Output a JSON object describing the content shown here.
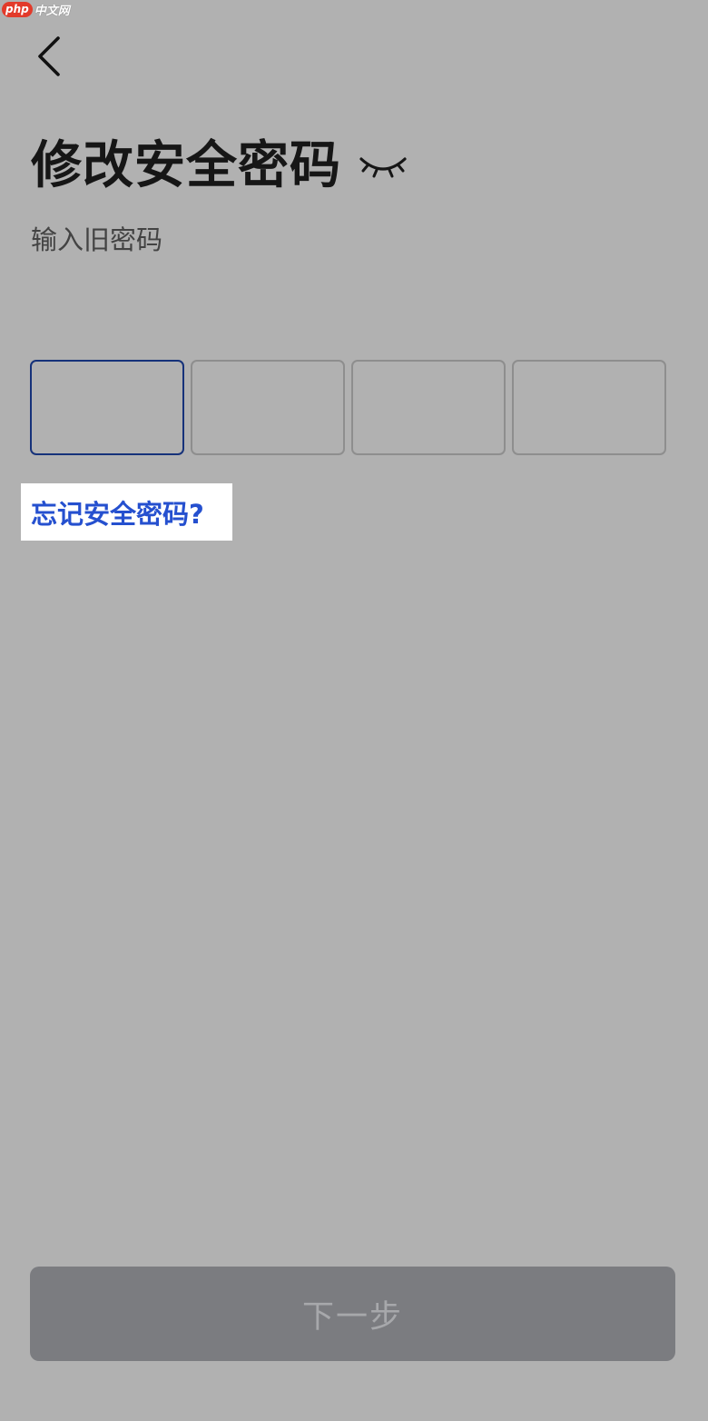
{
  "watermark": {
    "brand": "php",
    "site": "中文网"
  },
  "header": {
    "back_icon": "chevron-left-icon",
    "title": "修改安全密码",
    "toggle_icon": "eye-closed-icon",
    "subtitle": "输入旧密码"
  },
  "pin": {
    "length": 4,
    "active_index": 0,
    "values": [
      "",
      "",
      "",
      ""
    ]
  },
  "links": {
    "forgot": "忘记安全密码?"
  },
  "footer": {
    "next_label": "下一步"
  },
  "colors": {
    "background": "#b1b1b1",
    "link": "#2550cf",
    "active_border": "#16327a",
    "button_disabled": "#7b7c80"
  }
}
